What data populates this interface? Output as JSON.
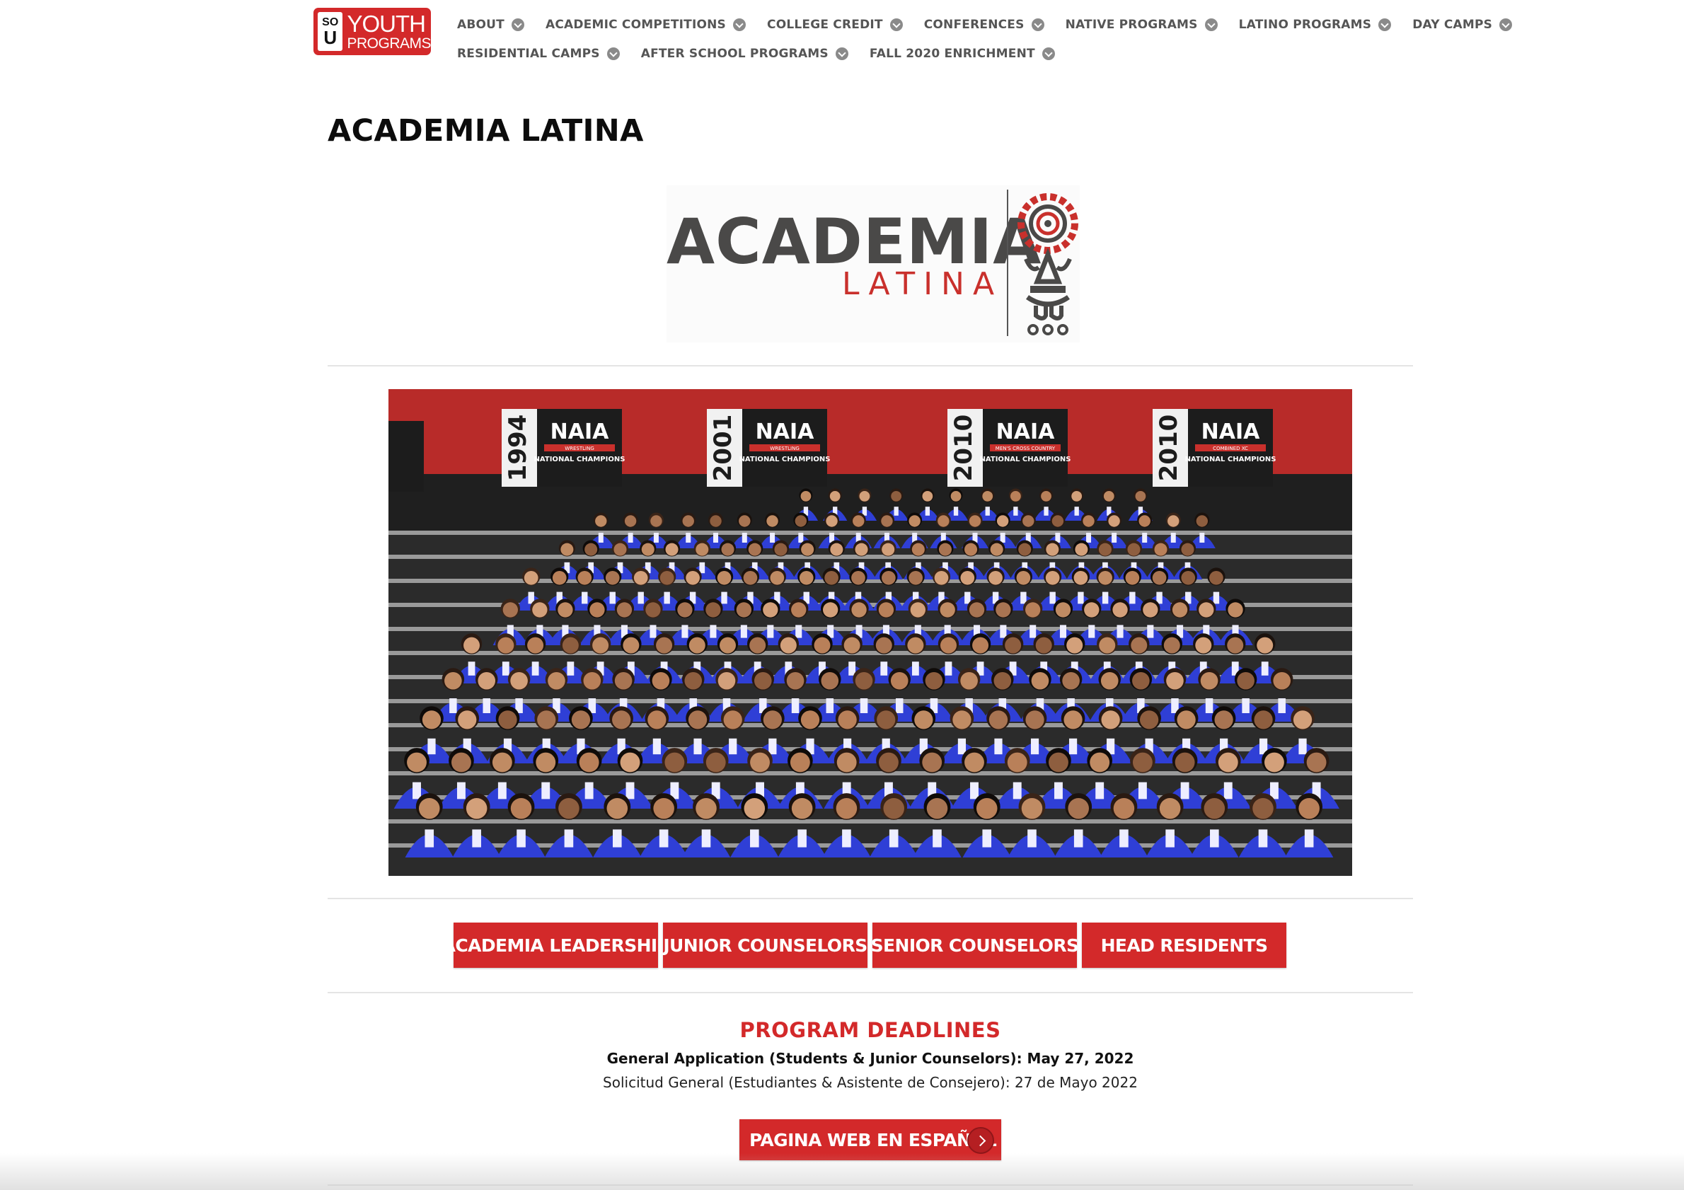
{
  "header": {
    "logo": {
      "mark_top": "SO",
      "mark_bottom": "U",
      "line1": "YOUTH",
      "line2": "PROGRAMS"
    },
    "nav_rows": [
      [
        {
          "label": "ABOUT"
        },
        {
          "label": "ACADEMIC COMPETITIONS"
        },
        {
          "label": "COLLEGE CREDIT"
        },
        {
          "label": "CONFERENCES"
        },
        {
          "label": "NATIVE PROGRAMS"
        },
        {
          "label": "LATINO PROGRAMS"
        },
        {
          "label": "DAY CAMPS"
        }
      ],
      [
        {
          "label": "RESIDENTIAL CAMPS"
        },
        {
          "label": "AFTER SCHOOL PROGRAMS"
        },
        {
          "label": "FALL 2020 ENRICHMENT"
        }
      ]
    ]
  },
  "page": {
    "title": "ACADEMIA LATINA"
  },
  "brand_logo": {
    "word1": "ACADEMIA",
    "word2": "LATINA"
  },
  "photo": {
    "banners": [
      {
        "year": "1994",
        "title": "NAIA",
        "sub": "WRESTLING",
        "caption": "NATIONAL CHAMPIONS"
      },
      {
        "year": "2001",
        "title": "NAIA",
        "sub": "WRESTLING",
        "caption": "NATIONAL CHAMPIONS"
      },
      {
        "year": "2010",
        "title": "NAIA",
        "sub": "MEN'S CROSS COUNTRY",
        "caption": "NATIONAL CHAMPIONS"
      },
      {
        "year": "2010",
        "title": "NAIA",
        "sub": "COMBINED XC",
        "caption": "NATIONAL CHAMPIONS"
      }
    ]
  },
  "buttons": [
    {
      "label": "ACADEMIA LEADERSHIP"
    },
    {
      "label": "JUNIOR COUNSELORS"
    },
    {
      "label": "SENIOR COUNSELORS"
    },
    {
      "label": "HEAD RESIDENTS"
    }
  ],
  "deadlines": {
    "title": "PROGRAM DEADLINES",
    "line1": "General Application (Students & Junior Counselors): May 27, 2022",
    "line2": "Solicitud General (Estudiantes & Asistente de Consejero): 27 de Mayo 2022"
  },
  "spanish_button": {
    "label": "PAGINA WEB EN ESPAÑOL"
  },
  "colors": {
    "brand_red": "#d3292a",
    "shirt_blue": "#2f3fd6",
    "wall_red": "#bf2f2c"
  }
}
